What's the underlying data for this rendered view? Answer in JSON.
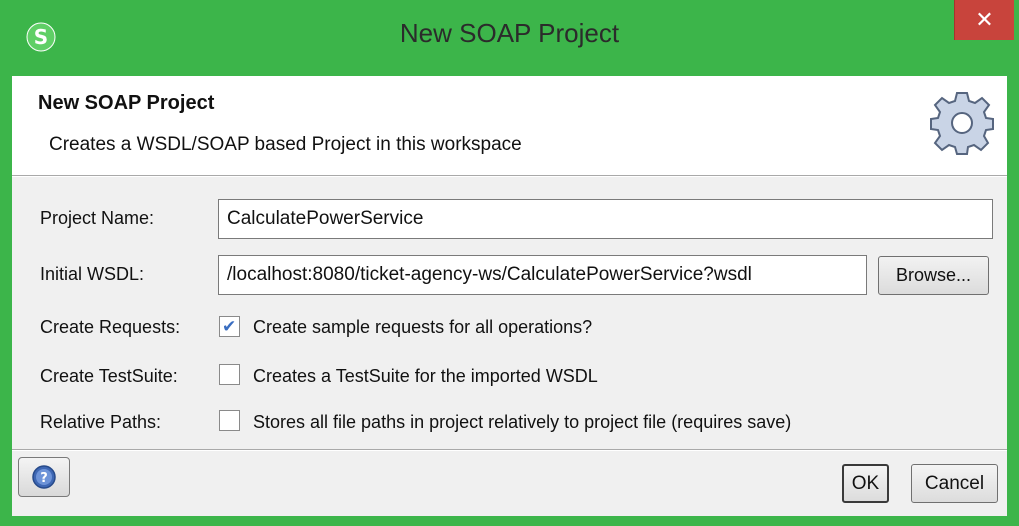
{
  "window": {
    "title": "New SOAP Project",
    "close_label": "✕",
    "accent_color": "#3cb54a",
    "close_color": "#c8443c"
  },
  "header": {
    "title": "New SOAP Project",
    "description": "Creates a WSDL/SOAP based Project in this workspace",
    "icon": "gear-icon"
  },
  "form": {
    "project_name": {
      "label": "Project Name:",
      "value": "CalculatePowerService"
    },
    "initial_wsdl": {
      "label": "Initial WSDL:",
      "value": "/localhost:8080/ticket-agency-ws/CalculatePowerService?wsdl",
      "browse_label": "Browse..."
    },
    "create_requests": {
      "label": "Create Requests:",
      "checked": true,
      "option_label": "Create sample requests for all operations?"
    },
    "create_testsuite": {
      "label": "Create TestSuite:",
      "checked": false,
      "option_label": "Creates a TestSuite for the imported WSDL"
    },
    "relative_paths": {
      "label": "Relative Paths:",
      "checked": false,
      "option_label": "Stores all file paths in project relatively to project file (requires save)"
    }
  },
  "footer": {
    "help_icon": "help-icon",
    "ok_label": "OK",
    "cancel_label": "Cancel"
  }
}
